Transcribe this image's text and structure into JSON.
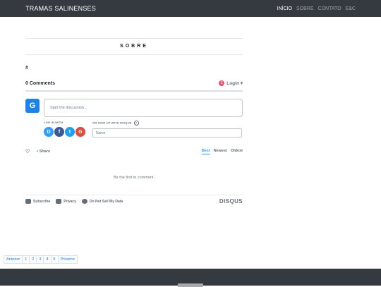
{
  "header": {
    "brand": "TRAMAS SALINENSES",
    "nav": [
      {
        "label": "INÍCIO",
        "active": true
      },
      {
        "label": "SOBRE",
        "active": false
      },
      {
        "label": "CONTATO",
        "active": false
      },
      {
        "label": "E&C",
        "active": false
      }
    ]
  },
  "page": {
    "title": "SOBRE",
    "hash": "#"
  },
  "disqus": {
    "count_label": "0 Comments",
    "notif_count": "1",
    "login_label": "Login ▾",
    "avatar_letter": "G",
    "compose_placeholder": "Start the discussion...",
    "login_with_label": "LOG IN WITH",
    "signup_label": "OR SIGN UP WITH DISQUS",
    "help_icon": "?",
    "socials": [
      {
        "label": "D",
        "icon": "disqus-icon",
        "color": "#2e9fff"
      },
      {
        "label": "f",
        "icon": "facebook-icon",
        "color": "#3b5998"
      },
      {
        "label": "t",
        "icon": "twitter-icon",
        "color": "#1da1f2"
      },
      {
        "label": "G",
        "icon": "google-icon",
        "color": "#dd4b39"
      }
    ],
    "name_placeholder": "Name",
    "heart_icon": "♡",
    "share_label": "Share",
    "sort": {
      "best": "Best",
      "newest": "Newest",
      "oldest": "Oldest"
    },
    "empty_text": "Be the first to comment.",
    "footer": {
      "subscribe": "Subscribe",
      "privacy": "Privacy",
      "do_not_sell": "Do Not Sell My Data",
      "logo": "DISQUS"
    }
  },
  "pagination": [
    "Anterior",
    "1",
    "2",
    "3",
    "4",
    "5",
    "Próximo"
  ]
}
